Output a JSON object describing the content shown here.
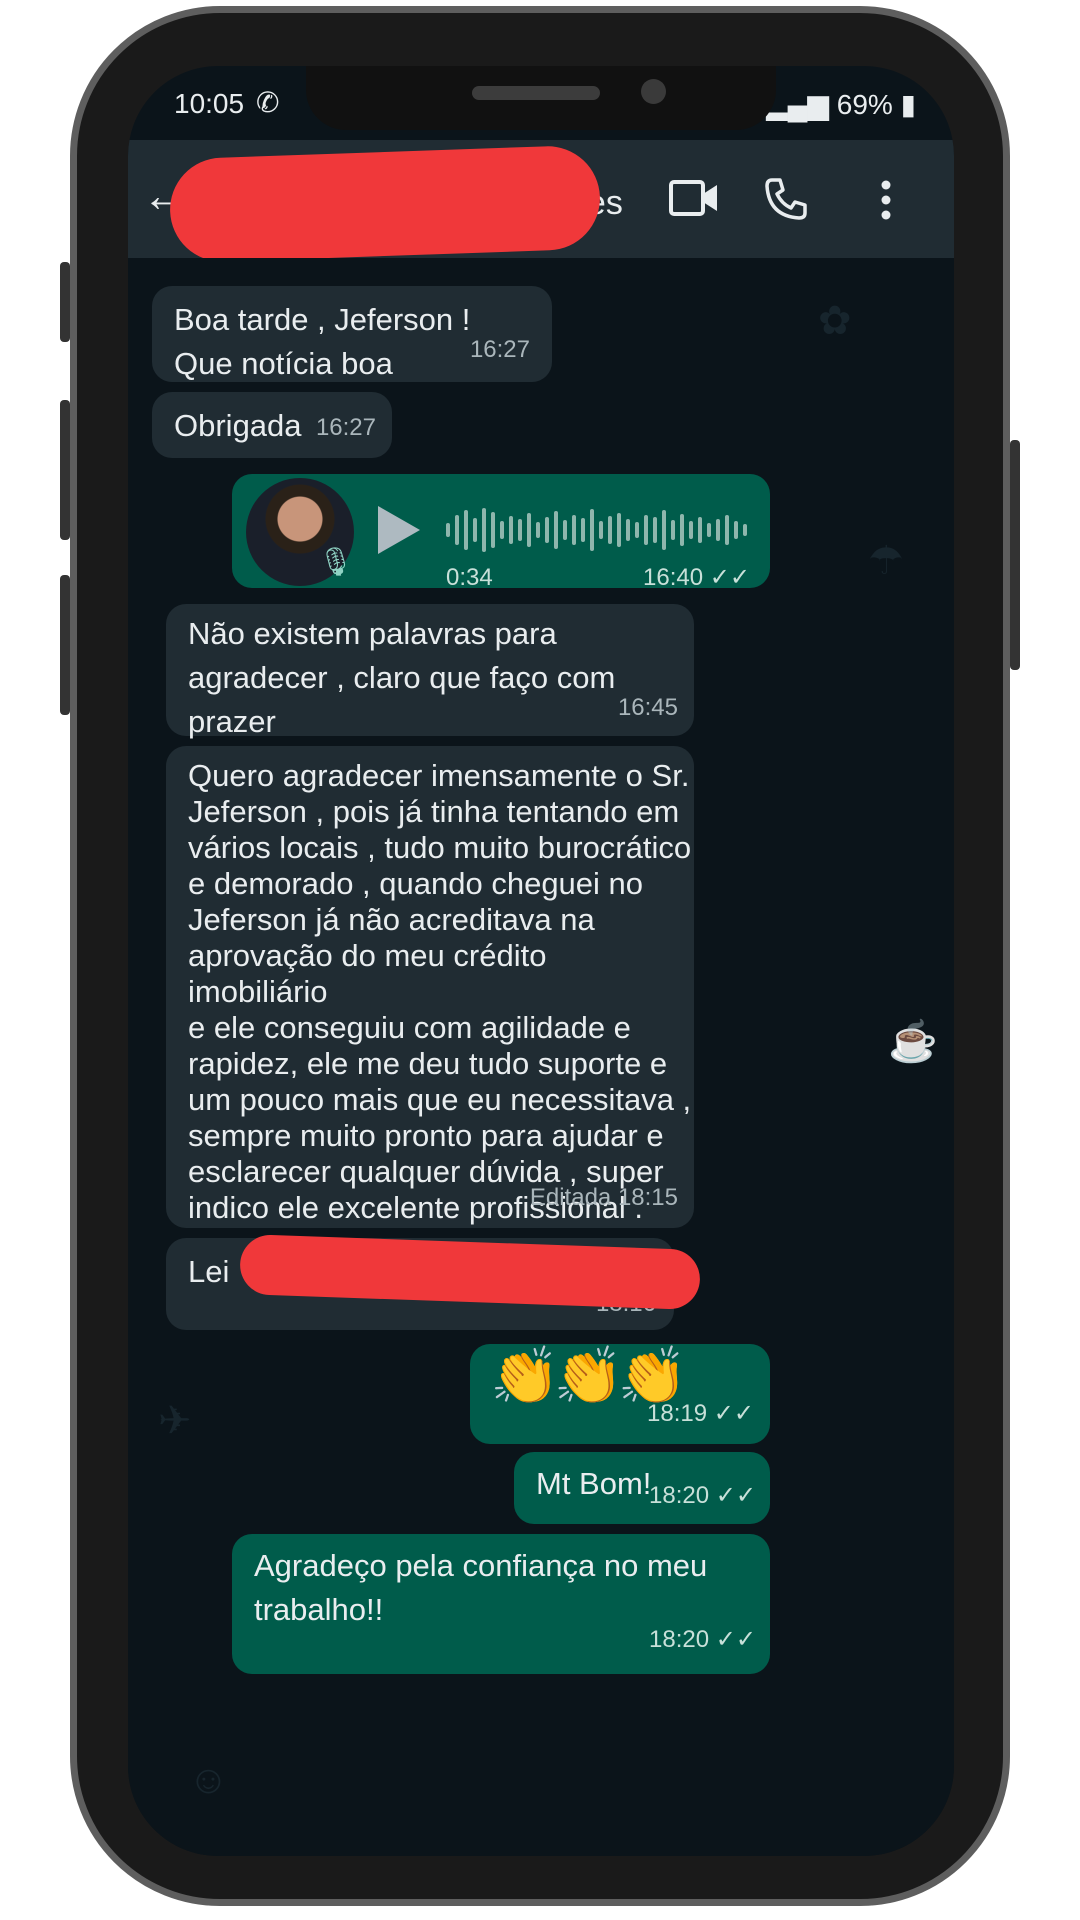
{
  "status_bar": {
    "time": "10:05",
    "battery": "69%"
  },
  "header": {
    "contact_name": "ues"
  },
  "icons": {
    "back": "arrow-back-icon",
    "video": "video-call-icon",
    "call": "phone-call-icon",
    "menu": "more-vert-icon",
    "play": "play-icon",
    "mic": "mic-icon",
    "whatsapp": "whatsapp-icon",
    "signal": "signal-icon",
    "battery": "battery-icon"
  },
  "messages": [
    {
      "direction": "in",
      "text": "Boa tarde , Jeferson !\nQue notícia boa",
      "time": "16:27"
    },
    {
      "direction": "in",
      "text": "Obrigada",
      "time": "16:27"
    },
    {
      "direction": "out",
      "type": "voice",
      "duration": "0:34",
      "time": "16:40",
      "status": "read"
    },
    {
      "direction": "in",
      "text": "Não existem palavras para\nagradecer , claro que faço com\nprazer",
      "time": "16:45"
    },
    {
      "direction": "in",
      "text": "Quero agradecer imensamente o Sr.\nJeferson , pois já tinha tentando em\nvários locais , tudo muito burocrático\ne demorado , quando cheguei no\nJeferson já não acreditava na\naprovação do meu crédito imobiliário\ne ele conseguiu com agilidade e\nrapidez, ele me deu tudo suporte e\num pouco mais que eu necessitava ,\nsempre muito pronto para ajudar e\nesclarecer qualquer dúvida , super\nindico ele excelente profissional .",
      "edited": "Editada",
      "time": "18:15"
    },
    {
      "direction": "in",
      "text": "Lei",
      "time": "18:16"
    },
    {
      "direction": "out",
      "emoji": "👏👏👏",
      "time": "18:19",
      "status": "read"
    },
    {
      "direction": "out",
      "text": "Mt Bom!",
      "time": "18:20",
      "status": "read"
    },
    {
      "direction": "out",
      "text": "Agradeço pela confiança no meu\ntrabalho!!",
      "time": "18:20",
      "status": "read"
    }
  ],
  "colors": {
    "incoming": "#202c33",
    "outgoing": "#005c4b",
    "background": "#0b141a",
    "redaction": "#f0383a"
  }
}
